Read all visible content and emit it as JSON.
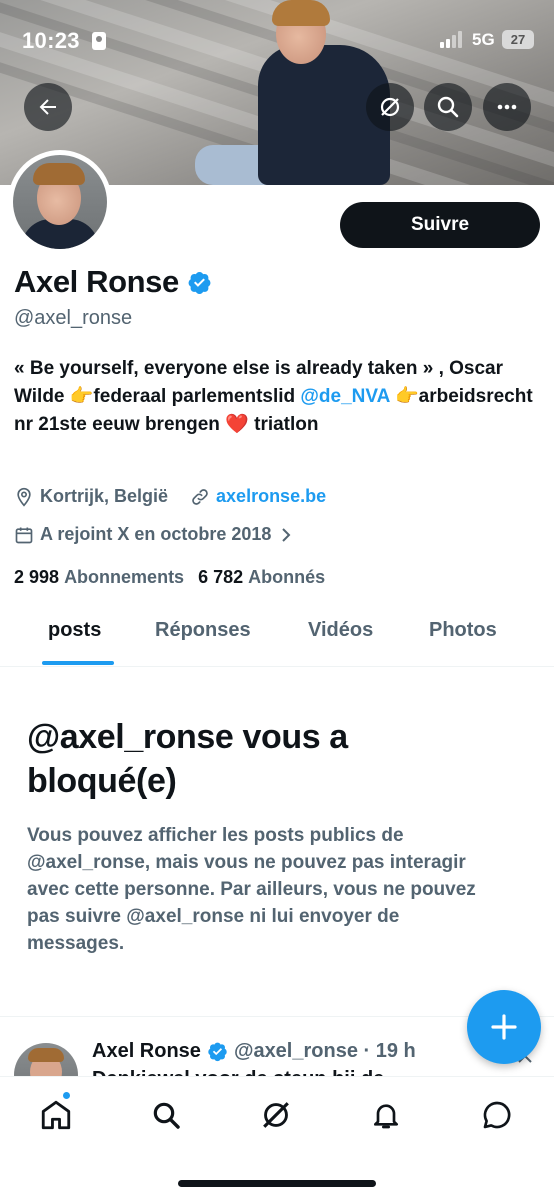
{
  "status_bar": {
    "time": "10:23",
    "network": "5G",
    "battery": "27"
  },
  "profile": {
    "name": "Axel Ronse",
    "handle": "@axel_ronse",
    "follow_label": "Suivre",
    "bio_part1": "« Be yourself, everyone else is already taken » , Oscar Wilde 👉federaal parlementslid ",
    "bio_mention": "@de_NVA",
    "bio_part2": " 👉arbeidsrecht nr 21ste eeuw brengen ❤️ triatlon",
    "location": "Kortrijk, België",
    "website": "axelronse.be",
    "joined": "A rejoint X en octobre 2018",
    "following_count": "2 998",
    "following_label": "Abonnements",
    "followers_count": "6 782",
    "followers_label": "Abonnés"
  },
  "tabs": [
    {
      "label": "posts"
    },
    {
      "label": "Réponses"
    },
    {
      "label": "Vidéos"
    },
    {
      "label": "Photos"
    }
  ],
  "blocked": {
    "title": "@axel_ronse vous a bloqué(e)",
    "body": "Vous pouvez afficher les posts publics de @axel_ronse, mais vous ne pouvez pas interagir avec cette personne. Par ailleurs, vous ne pouvez pas suivre @axel_ronse ni lui envoyer de messages."
  },
  "post": {
    "name": "Axel Ronse",
    "handle_time": "@axel_ronse · 19 h",
    "text_fragment": "Dankjewel voor de steun bij de..."
  },
  "colors": {
    "accent": "#1d9bf0",
    "text": "#0f1419",
    "secondary": "#536471"
  },
  "icons": [
    "back-arrow-icon",
    "grok-icon",
    "search-icon",
    "more-icon",
    "location-icon",
    "link-icon",
    "calendar-icon",
    "chevron-right-icon",
    "verified-badge-icon",
    "plus-icon",
    "home-icon",
    "search-icon",
    "grok-icon",
    "bell-icon",
    "chat-icon"
  ]
}
